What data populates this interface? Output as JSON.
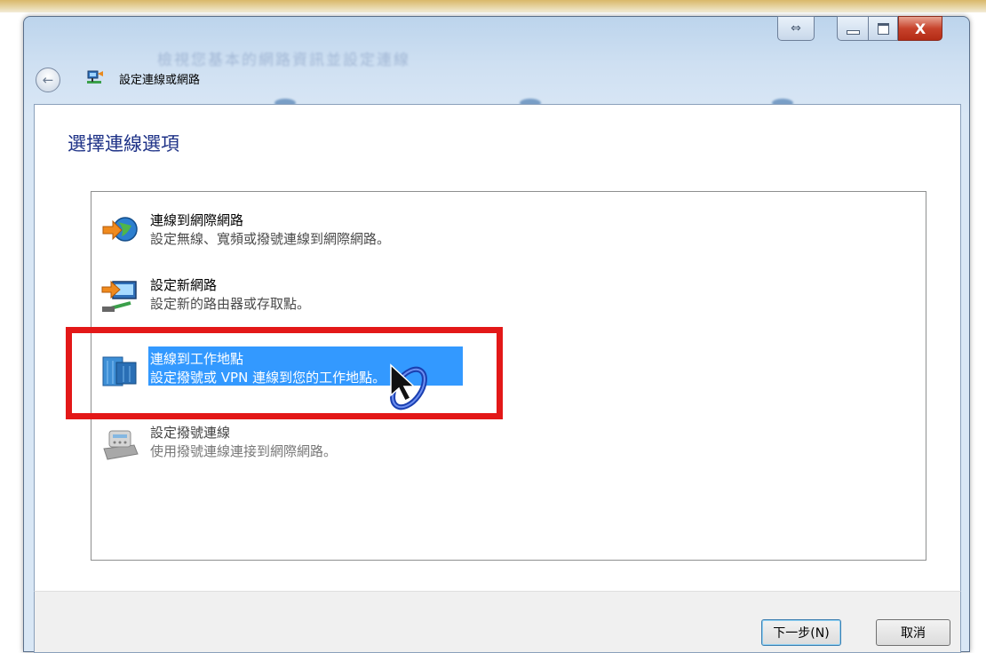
{
  "window": {
    "title": "設定連線或網路",
    "ghost_title": "檢視您基本的網路資訊並設定連線",
    "close_glyph": "X",
    "resize_glyph": "⇔",
    "back_glyph": "←"
  },
  "page": {
    "heading": "選擇連線選項"
  },
  "options": [
    {
      "title": "連線到網際網路",
      "description": "設定無線、寬頻或撥號連線到網際網路。"
    },
    {
      "title": "設定新網路",
      "description": "設定新的路由器或存取點。"
    },
    {
      "title": "連線到工作地點",
      "description": "設定撥號或 VPN 連線到您的工作地點。",
      "selected": true
    },
    {
      "title": "設定撥號連線",
      "description": "使用撥號連線連接到網際網路。"
    }
  ],
  "buttons": {
    "next": "下一步(N)",
    "cancel": "取消"
  },
  "colors": {
    "selection": "#3399ff",
    "highlight_box": "#e31818",
    "heading": "#1e3287"
  }
}
